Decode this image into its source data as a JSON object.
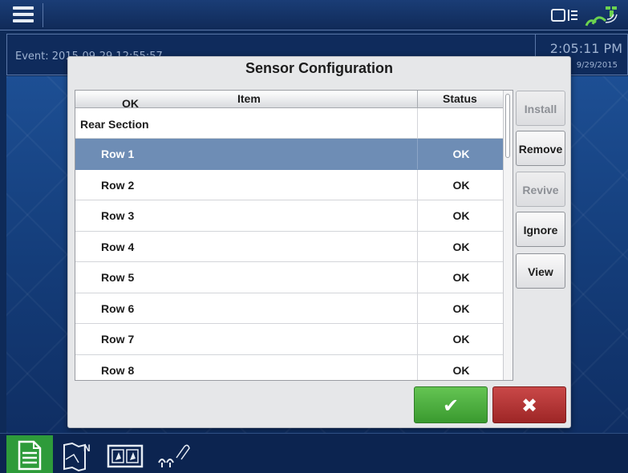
{
  "topbar": {
    "menu_icon": "hamburger-menu-icon",
    "display_icon": "display-config-icon",
    "gps_icon": "gps-satellite-icon"
  },
  "eventbar": {
    "event_text": "Event: 2015-09-29 12:55:57",
    "time": "2:05:11 PM",
    "date": "9/29/2015"
  },
  "dialog": {
    "title": "Sensor Configuration",
    "columns": {
      "ok": "OK",
      "item": "Item",
      "status": "Status"
    },
    "rows": [
      {
        "item": "Rear Section",
        "status": "",
        "type": "section",
        "selected": false
      },
      {
        "item": "Row 1",
        "status": "OK",
        "type": "sub",
        "selected": true
      },
      {
        "item": "Row 2",
        "status": "OK",
        "type": "sub",
        "selected": false
      },
      {
        "item": "Row 3",
        "status": "OK",
        "type": "sub",
        "selected": false
      },
      {
        "item": "Row 4",
        "status": "OK",
        "type": "sub",
        "selected": false
      },
      {
        "item": "Row 5",
        "status": "OK",
        "type": "sub",
        "selected": false
      },
      {
        "item": "Row 6",
        "status": "OK",
        "type": "sub",
        "selected": false
      },
      {
        "item": "Row 7",
        "status": "OK",
        "type": "sub",
        "selected": false
      },
      {
        "item": "Row 8",
        "status": "OK",
        "type": "sub",
        "selected": false
      }
    ],
    "buttons": {
      "install": "Install",
      "remove": "Remove",
      "revive": "Revive",
      "ignore": "Ignore",
      "view": "View",
      "accept_icon": "checkmark-icon",
      "cancel_icon": "x-icon"
    }
  },
  "bottombar": {
    "tabs": [
      {
        "name": "run-page-tab",
        "icon": "document-icon",
        "active": true
      },
      {
        "name": "map-tab",
        "icon": "map-north-icon",
        "active": false
      },
      {
        "name": "split-view-tab",
        "icon": "split-view-icon",
        "active": false
      },
      {
        "name": "planting-tab",
        "icon": "seed-planting-icon",
        "active": false
      }
    ]
  },
  "colors": {
    "selected_row": "#6e8db5",
    "accept_green": "#3a9a2f",
    "cancel_red": "#9e2626",
    "active_tab": "#2e9b3a"
  }
}
